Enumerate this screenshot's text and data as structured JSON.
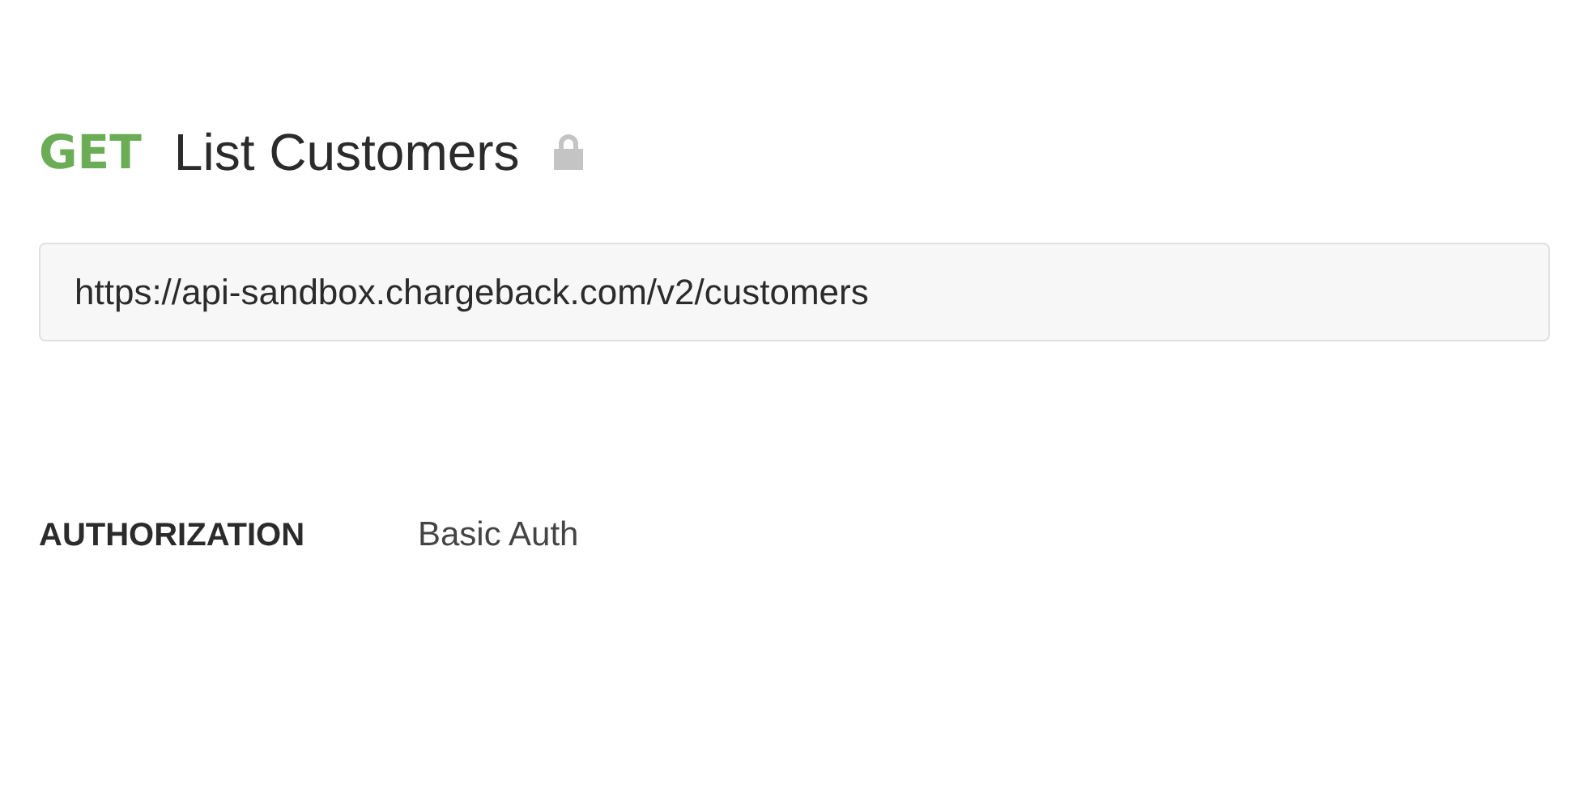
{
  "request": {
    "method": "GET",
    "title": "List Customers",
    "locked": true,
    "url": "https://api-sandbox.chargeback.com/v2/customers"
  },
  "authorization": {
    "label": "AUTHORIZATION",
    "value": "Basic Auth"
  }
}
